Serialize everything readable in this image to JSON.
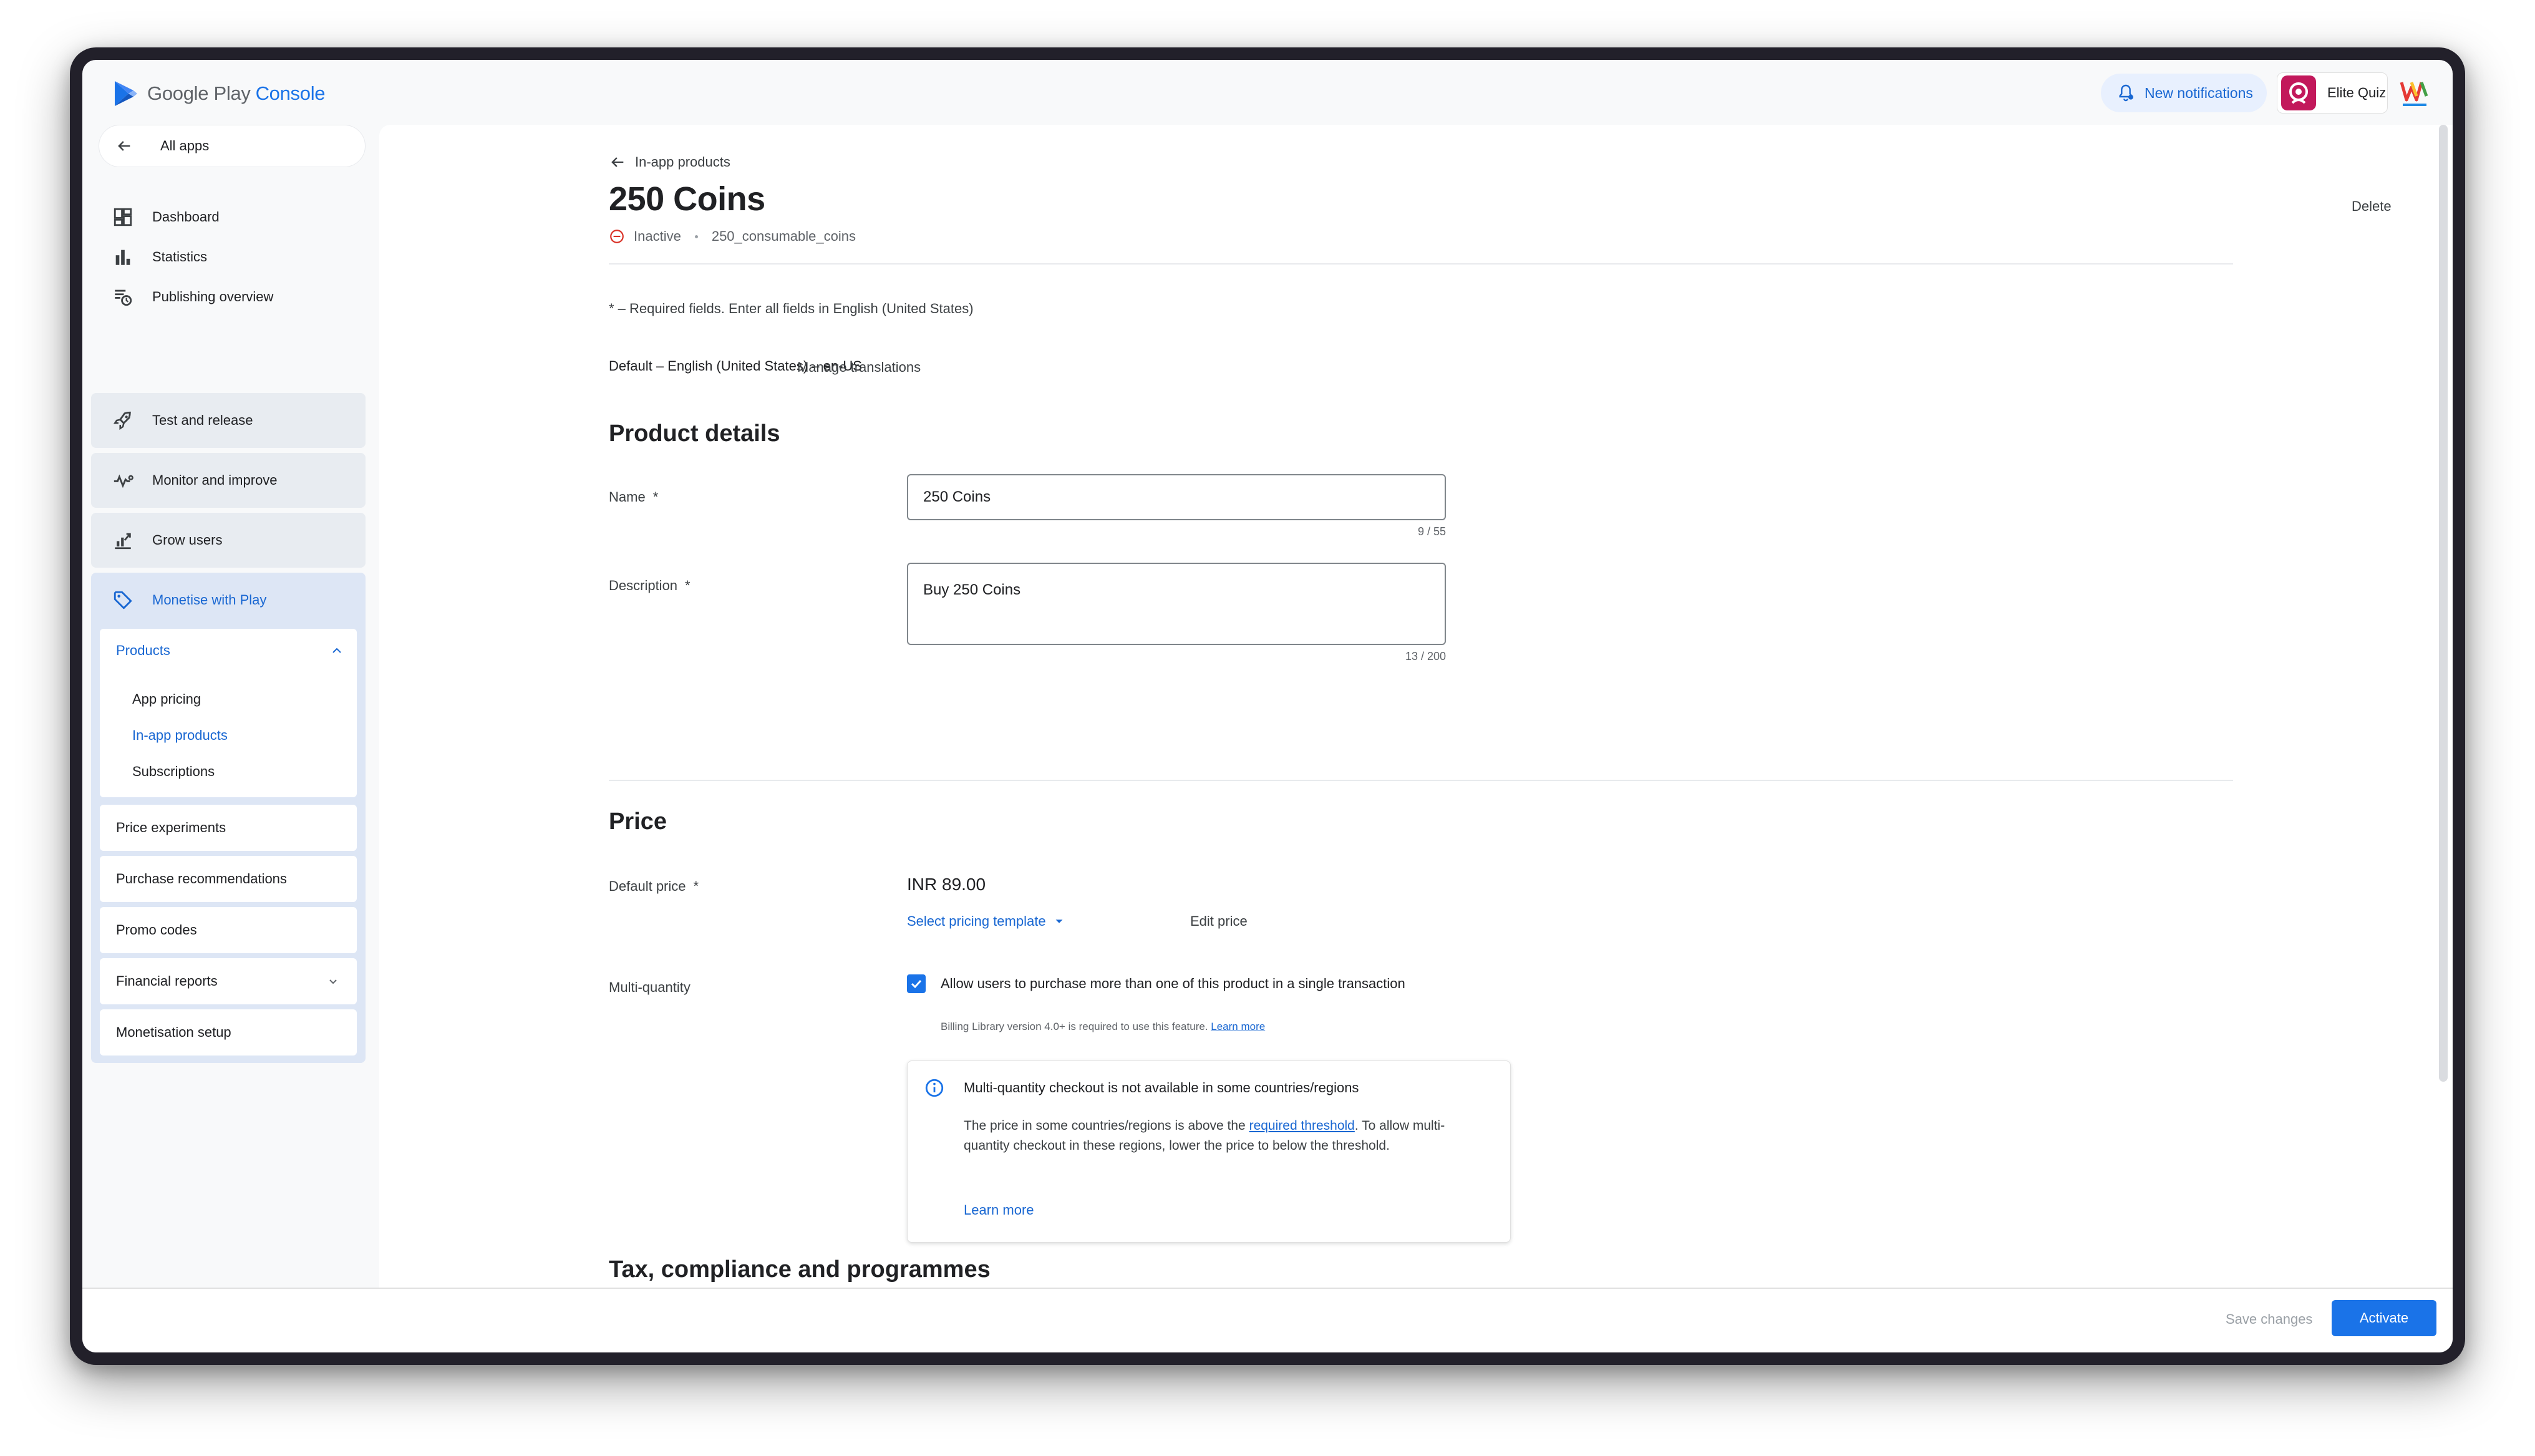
{
  "header": {
    "logo_primary": "Google Play",
    "logo_secondary": "Console",
    "notifications_label": "New notifications",
    "account_name": "Elite Quiz"
  },
  "sidebar": {
    "all_apps": "All apps",
    "top_items": [
      {
        "label": "Dashboard",
        "icon": "dashboard-icon"
      },
      {
        "label": "Statistics",
        "icon": "bar-chart-icon"
      },
      {
        "label": "Publishing overview",
        "icon": "publish-clock-icon"
      }
    ],
    "sections": [
      {
        "label": "Test and release",
        "icon": "rocket-icon"
      },
      {
        "label": "Monitor and improve",
        "icon": "pulse-icon"
      },
      {
        "label": "Grow users",
        "icon": "growth-icon"
      }
    ],
    "monetise": {
      "label": "Monetise with Play",
      "products": "Products",
      "sub_items": [
        "App pricing",
        "In-app products",
        "Subscriptions"
      ],
      "cards": [
        "Price experiments",
        "Purchase recommendations",
        "Promo codes",
        "Financial reports",
        "Monetisation setup"
      ]
    }
  },
  "page": {
    "back_label": "In-app products",
    "title": "250 Coins",
    "delete_label": "Delete",
    "status": "Inactive",
    "product_id": "250_consumable_coins",
    "required_note": "* – Required fields. Enter all fields in English (United States)",
    "default_language": "Default – English (United States) – en-US",
    "manage_translations": "Manage translations"
  },
  "product_details": {
    "title": "Product details",
    "name_label": "Name",
    "name_value": "250 Coins",
    "name_counter": "9 / 55",
    "description_label": "Description",
    "description_value": "Buy 250 Coins",
    "description_counter": "13 / 200",
    "required_mark": "*"
  },
  "price": {
    "title": "Price",
    "default_price_label": "Default price",
    "default_price_value": "INR 89.00",
    "select_template": "Select pricing template",
    "edit_price": "Edit price",
    "multi_quantity_label": "Multi-quantity",
    "checkbox_label": "Allow users to purchase more than one of this product in a single transaction",
    "billing_note": "Billing Library version 4.0+ is required to use this feature.",
    "billing_learn_more": "Learn more",
    "info_title": "Multi-quantity checkout is not available in some countries/regions",
    "info_body_pre": "The price in some countries/regions is above the ",
    "info_body_link": "required threshold",
    "info_body_post": ". To allow multi-quantity checkout in these regions, lower the price to below the threshold.",
    "info_learn_more": "Learn more"
  },
  "next_section_title": "Tax, compliance and programmes",
  "footer": {
    "save_label": "Save changes",
    "activate_label": "Activate"
  },
  "colors": {
    "accent": "#1a73e8",
    "accent_text": "#1967d2",
    "inactive": "#d93025"
  }
}
